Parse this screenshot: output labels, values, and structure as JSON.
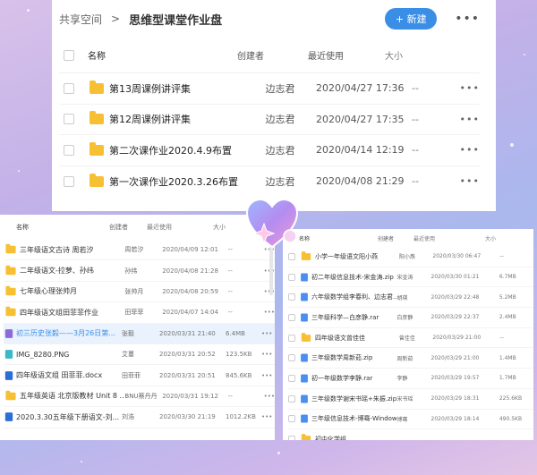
{
  "top": {
    "breadcrumb_root": "共享空间",
    "separator": ">",
    "title": "思维型课堂作业盘",
    "new_button": "+ 新建",
    "more": "•••",
    "headers": {
      "name": "名称",
      "creator": "创建者",
      "last_used": "最近使用",
      "size": "大小"
    },
    "rows": [
      {
        "name": "第13周课例讲评集",
        "creator": "边志君",
        "date": "2020/04/27 17:36",
        "size": "--",
        "more": "•••"
      },
      {
        "name": "第12周课例讲评集",
        "creator": "边志君",
        "date": "2020/04/27 17:35",
        "size": "--",
        "more": "•••"
      },
      {
        "name": "第二次课作业2020.4.9布置",
        "creator": "边志君",
        "date": "2020/04/14 12:19",
        "size": "--",
        "more": "•••"
      },
      {
        "name": "第一次课作业2020.3.26布置",
        "creator": "边志君",
        "date": "2020/04/08 21:29",
        "size": "--",
        "more": "•••"
      }
    ]
  },
  "left": {
    "headers": {
      "name": "名称",
      "creator": "创建者",
      "last_used": "最近使用",
      "size": "大小"
    },
    "rows": [
      {
        "name": "三年级语文古诗 周若汐",
        "creator": "周若汐",
        "date": "2020/04/09 12:01",
        "size": "--",
        "icon": "folder"
      },
      {
        "name": "二年级语文-拉萝、孙纬",
        "creator": "孙纬",
        "date": "2020/04/08 21:28",
        "size": "--",
        "icon": "folder"
      },
      {
        "name": "七年级心理张帅月",
        "creator": "张帅月",
        "date": "2020/04/08 20:59",
        "size": "--",
        "icon": "folder"
      },
      {
        "name": "四年级语文组田菲菲作业",
        "creator": "田菲菲",
        "date": "2020/04/07 14:04",
        "size": "--",
        "icon": "folder"
      },
      {
        "name": "初三历史张毅——3月26日第...",
        "creator": "张毅",
        "date": "2020/03/31 21:40",
        "size": "6.4MB",
        "icon": "video",
        "selected": true
      },
      {
        "name": "IMG_8280.PNG",
        "creator": "艾蔓",
        "date": "2020/03/31 20:52",
        "size": "123.5KB",
        "icon": "image"
      },
      {
        "name": "四年级语文组 田菲菲.docx",
        "creator": "田菲菲",
        "date": "2020/03/31 20:51",
        "size": "845.6KB",
        "icon": "doc"
      },
      {
        "name": "五年级英语 北京版教材 Unit 8 ...",
        "creator": "BNU蔡丹丹",
        "date": "2020/03/31 19:12",
        "size": "--",
        "icon": "folder"
      },
      {
        "name": "2020.3.30五年级下册语文-刘...",
        "creator": "刘浩",
        "date": "2020/03/30 21:19",
        "size": "1012.2KB",
        "icon": "doc"
      }
    ]
  },
  "right": {
    "headers": {
      "name": "名称",
      "creator": "创建者",
      "last_used": "最近使用",
      "size": "大小"
    },
    "rows": [
      {
        "name": "小学一年级语文阳小燕",
        "creator": "阳小燕",
        "date": "2020/03/30 06:47",
        "size": "--",
        "icon": "folder"
      },
      {
        "name": "初二年级信息技术-宋金涛.zip",
        "creator": "宋金涛",
        "date": "2020/03/30 01:21",
        "size": "6.7MB",
        "icon": "zip"
      },
      {
        "name": "六年级数学组李春利、边志君...",
        "creator": "胡瑛",
        "date": "2020/03/29 22:48",
        "size": "5.2MB",
        "icon": "zip"
      },
      {
        "name": "三年级科学—白彦静.rar",
        "creator": "白彦静",
        "date": "2020/03/29 22:37",
        "size": "2.4MB",
        "icon": "zip"
      },
      {
        "name": "四年级语文曾佳佳",
        "creator": "曾佳佳",
        "date": "2020/03/29 21:00",
        "size": "--",
        "icon": "folder"
      },
      {
        "name": "三年级数学周新茹.zip",
        "creator": "周新茹",
        "date": "2020/03/29 21:00",
        "size": "1.4MB",
        "icon": "zip"
      },
      {
        "name": "初一年级数学李静.rar",
        "creator": "李静",
        "date": "2020/03/29 19:57",
        "size": "1.7MB",
        "icon": "zip"
      },
      {
        "name": "三年级数学谢宋书瑶+朱振.zip",
        "creator": "宋书瑶",
        "date": "2020/03/29 18:31",
        "size": "225.6KB",
        "icon": "zip"
      },
      {
        "name": "三年级信息技术-博骞-Window...",
        "creator": "博骞",
        "date": "2020/03/29 18:14",
        "size": "490.5KB",
        "icon": "zip"
      },
      {
        "name": "初中化学组",
        "creator": "",
        "date": "",
        "size": "",
        "icon": "folder"
      }
    ]
  },
  "colors": {
    "accent": "#3b8ee6",
    "folder": "#f7c033",
    "zip": "#4a8ef0",
    "doc": "#2b6fd6",
    "video": "#8d6ad9",
    "image": "#3db8c5"
  }
}
